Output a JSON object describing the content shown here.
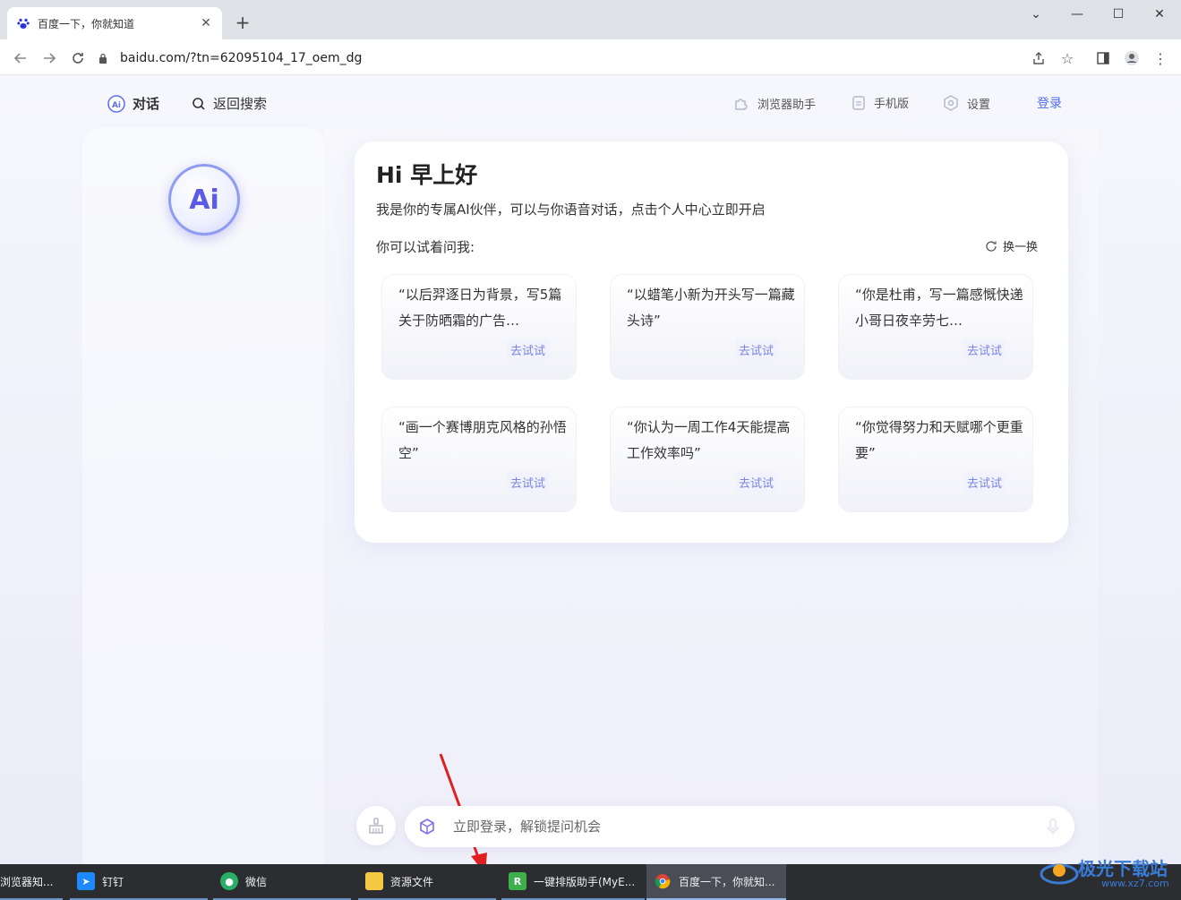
{
  "browser": {
    "tab_title": "百度一下，你就知道",
    "url": "baidu.com/?tn=62095104_17_oem_dg"
  },
  "topnav": {
    "chat": "对话",
    "back_search": "返回搜索",
    "browser_helper": "浏览器助手",
    "mobile": "手机版",
    "settings": "设置",
    "login": "登录"
  },
  "avatar_text": "Ai",
  "main": {
    "greeting": "Hi 早上好",
    "intro": "我是你的专属AI伙伴，可以与你语音对话，点击个人中心立即开启",
    "try_ask": "你可以试着问我:",
    "refresh": "换一换",
    "suggestions": [
      {
        "text": "“以后羿逐日为背景，写5篇关于防晒霜的广告…",
        "action": "去试试"
      },
      {
        "text": "“以蜡笔小新为开头写一篇藏头诗”",
        "action": "去试试"
      },
      {
        "text": "“你是杜甫，写一篇感慨快递小哥日夜辛劳七…",
        "action": "去试试"
      },
      {
        "text": "“画一个赛博朋克风格的孙悟空”",
        "action": "去试试"
      },
      {
        "text": "“你认为一周工作4天能提高工作效率吗”",
        "action": "去试试"
      },
      {
        "text": "“你觉得努力和天赋哪个更重要”",
        "action": "去试试"
      }
    ]
  },
  "input": {
    "placeholder": "立即登录，解锁提问机会"
  },
  "taskbar": [
    {
      "label": "浏览器知...",
      "icon": "browser-icon"
    },
    {
      "label": "钉钉",
      "icon": "dingtalk-icon"
    },
    {
      "label": "微信",
      "icon": "wechat-icon"
    },
    {
      "label": "资源文件",
      "icon": "folder-icon"
    },
    {
      "label": "一键排版助手(MyE...",
      "icon": "app-icon"
    },
    {
      "label": "百度一下，你就知...",
      "icon": "chrome-icon"
    }
  ],
  "watermark": {
    "text": "极光下载站",
    "url": "www.xz7.com"
  },
  "colors": {
    "accent": "#4e6ef2",
    "try_button": "#7a86e0",
    "annotation_arrow": "#e02020"
  }
}
